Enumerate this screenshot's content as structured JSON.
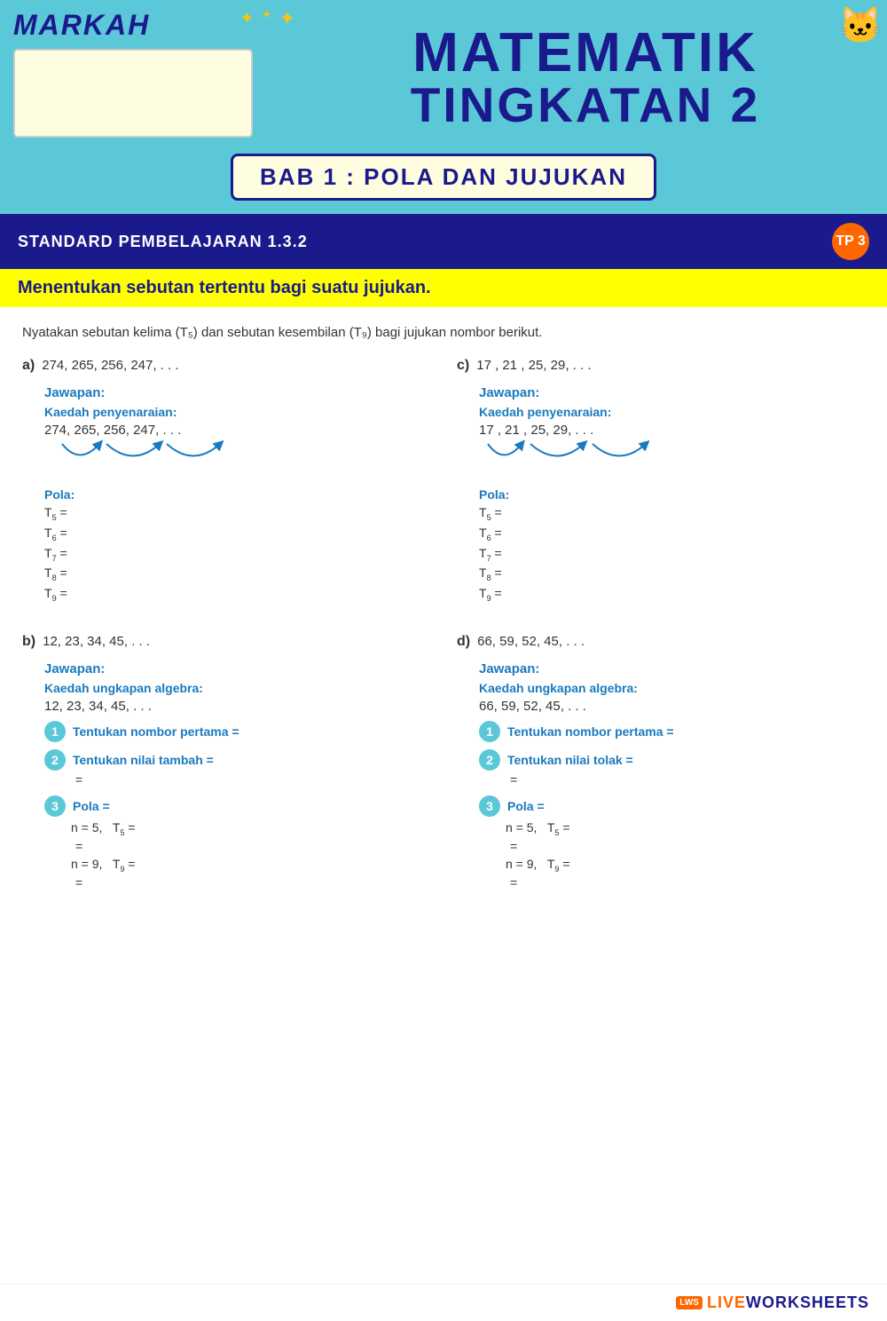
{
  "header": {
    "markah_label": "MARKAH",
    "main_title": "MATEMATIK",
    "main_title_line2": "TINGKATAN 2",
    "bab_title": "BAB 1 : POLA DAN JUJUKAN",
    "standard_label": "STANDARD PEMBELAJARAN 1.3.2",
    "tp_badge": "TP 3",
    "objective": "Menentukan sebutan tertentu bagi suatu jujukan."
  },
  "instruction": "Nyatakan sebutan kelima (T₅) dan sebutan kesembilan (T₉) bagi jujukan nombor berikut.",
  "questions": {
    "a": {
      "label": "a)",
      "sequence": "274,   265,   256,   247, . . .",
      "jawapan": "Jawapan:",
      "kaedah": "Kaedah penyenaraian:",
      "seq_repeat": "274,   265,   256,   247, . . .",
      "pola": "Pola:",
      "t5": "T₅ =",
      "t6": "T₆ =",
      "t7": "T₇ =",
      "t8": "T₈ =",
      "t9": "T₉ ="
    },
    "b": {
      "label": "b)",
      "sequence": "12,   23,   34,   45, . . .",
      "jawapan": "Jawapan:",
      "kaedah": "Kaedah ungkapan algebra:",
      "seq_repeat": "12,   23,   34,   45, . . .",
      "step1_circle": "1",
      "step1_text": "Tentukan nombor pertama =",
      "step2_circle": "2",
      "step2_text": "Tentukan nilai tambah =",
      "equals1": "=",
      "step3_circle": "3",
      "step3_text": "Pola =",
      "n5_line": "n = 5,   T₅ =",
      "equals2": "=",
      "n9_line": "n = 9,   T₉ =",
      "equals3": "="
    },
    "c": {
      "label": "c)",
      "sequence": "17 ,    21 ,    25,    29, . . .",
      "jawapan": "Jawapan:",
      "kaedah": "Kaedah penyenaraian:",
      "seq_repeat": "17 ,    21 ,    25,    29, . . .",
      "pola": "Pola:",
      "t5": "T₅ =",
      "t6": "T₆ =",
      "t7": "T₇ =",
      "t8": "T₈ =",
      "t9": "T₉ ="
    },
    "d": {
      "label": "d)",
      "sequence": "66,   59,   52,   45, . . .",
      "jawapan": "Jawapan:",
      "kaedah": "Kaedah ungkapan algebra:",
      "seq_repeat": "66,   59,   52,   45, . . .",
      "step1_circle": "1",
      "step1_text": "Tentukan nombor pertama =",
      "step2_circle": "2",
      "step2_text": "Tentukan nilai tolak =",
      "equals1": "=",
      "step3_circle": "3",
      "step3_text": "Pola =",
      "n5_line": "n = 5,   T₅ =",
      "equals2": "=",
      "n9_line": "n = 9,   T₉ =",
      "equals3": "="
    }
  },
  "footer": {
    "lws_brand": "LIVEWORKSHEETS",
    "lws_prefix": "LIVE"
  },
  "colors": {
    "blue_dark": "#1a1a8c",
    "teal": "#5bc8d8",
    "yellow": "#ffff00",
    "orange": "#ff6600",
    "blue_text": "#1a7abf"
  }
}
